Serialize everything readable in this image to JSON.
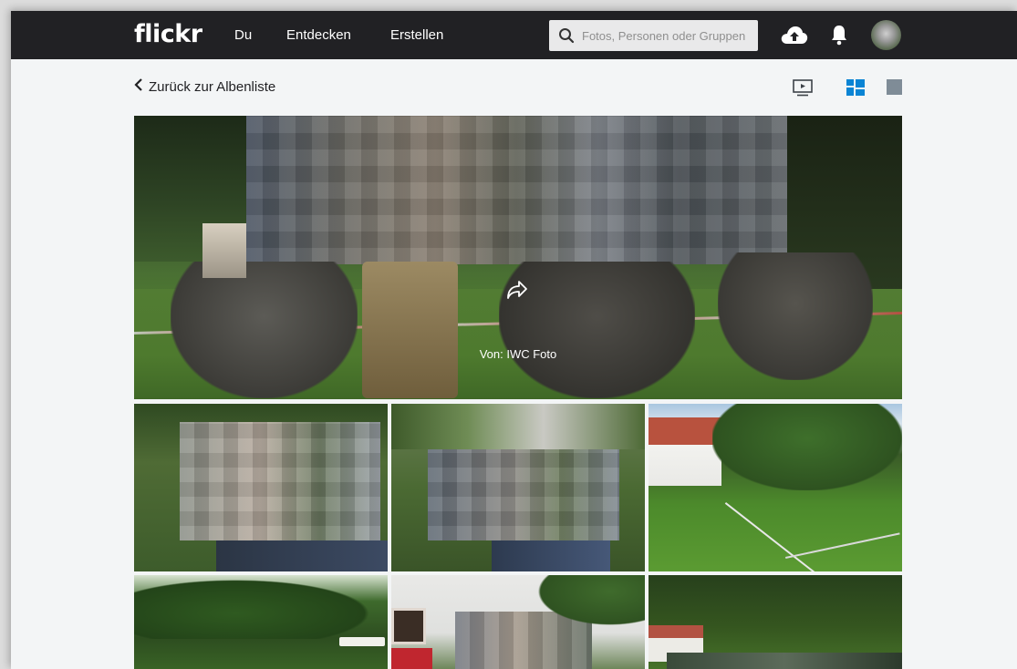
{
  "header": {
    "logo": "flickr",
    "nav": [
      "Du",
      "Entdecken",
      "Erstellen"
    ],
    "search_placeholder": "Fotos, Personen oder Gruppen",
    "icons": [
      "upload-cloud-icon",
      "notification-bell-icon",
      "user-avatar"
    ]
  },
  "album": {
    "back_label": "Zurück zur Albenliste",
    "view_modes": [
      "slideshow-icon",
      "mosaic-view-icon",
      "single-view-icon"
    ],
    "active_view": "mosaic-view-icon"
  },
  "cover": {
    "caption": "Von: IWC Foto"
  },
  "colors": {
    "topbar": "#212124",
    "page_bg": "#f3f5f6",
    "accent_blue": "#0a84d4",
    "icon_grey": "#7f8c97"
  }
}
